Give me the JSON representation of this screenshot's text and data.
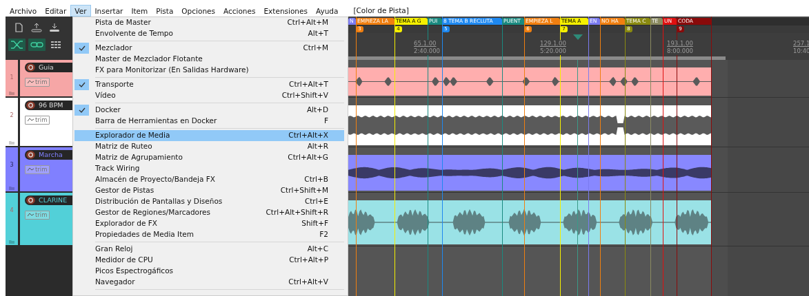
{
  "menubar": {
    "items": [
      {
        "label": "Archivo",
        "selected": false
      },
      {
        "label": "Editar",
        "selected": false
      },
      {
        "label": "Ver",
        "selected": true
      },
      {
        "label": "Insertar",
        "selected": false
      },
      {
        "label": "Item",
        "selected": false
      },
      {
        "label": "Pista",
        "selected": false
      },
      {
        "label": "Opciones",
        "selected": false
      },
      {
        "label": "Acciones",
        "selected": false
      },
      {
        "label": "Extensiones",
        "selected": false
      },
      {
        "label": "Ayuda",
        "selected": false
      }
    ],
    "status_text": "[Color de Pista]"
  },
  "view_menu": [
    {
      "kind": "item",
      "label": "Pista de Master",
      "shortcut": "Ctrl+Alt+M",
      "checked": false,
      "selected": false
    },
    {
      "kind": "item",
      "label": "Envolvente de Tempo",
      "shortcut": "Alt+T",
      "checked": false,
      "selected": false
    },
    {
      "kind": "separator"
    },
    {
      "kind": "item",
      "label": "Mezclador",
      "shortcut": "Ctrl+M",
      "checked": true,
      "selected": false
    },
    {
      "kind": "item",
      "label": "Master de Mezclador Flotante",
      "checked": false,
      "selected": false
    },
    {
      "kind": "item",
      "label": "FX para Monitorizar (En Salidas Hardware)",
      "checked": false,
      "selected": false
    },
    {
      "kind": "separator"
    },
    {
      "kind": "item",
      "label": "Transporte",
      "shortcut": "Ctrl+Alt+T",
      "checked": true,
      "selected": false
    },
    {
      "kind": "item",
      "label": "Vídeo",
      "shortcut": "Ctrl+Shift+V",
      "checked": false,
      "selected": false
    },
    {
      "kind": "separator"
    },
    {
      "kind": "item",
      "label": "Docker",
      "shortcut": "Alt+D",
      "checked": true,
      "selected": false
    },
    {
      "kind": "item",
      "label": "Barra de Herramientas en Docker",
      "shortcut": "F",
      "checked": false,
      "selected": false
    },
    {
      "kind": "separator"
    },
    {
      "kind": "item",
      "label": "Explorador de Media",
      "shortcut": "Ctrl+Alt+X",
      "checked": false,
      "selected": true
    },
    {
      "kind": "item",
      "label": "Matriz de Ruteo",
      "shortcut": "Alt+R",
      "checked": false,
      "selected": false
    },
    {
      "kind": "item",
      "label": "Matriz de Agrupamiento",
      "shortcut": "Ctrl+Alt+G",
      "checked": false,
      "selected": false
    },
    {
      "kind": "item",
      "label": "Track Wiring",
      "checked": false,
      "selected": false
    },
    {
      "kind": "item",
      "label": "Almacén de Proyecto/Bandeja FX",
      "shortcut": "Ctrl+B",
      "checked": false,
      "selected": false
    },
    {
      "kind": "item",
      "label": "Gestor de Pistas",
      "shortcut": "Ctrl+Shift+M",
      "checked": false,
      "selected": false
    },
    {
      "kind": "item",
      "label": "Distribución de Pantallas y Diseños",
      "shortcut": "Ctrl+E",
      "checked": false,
      "selected": false
    },
    {
      "kind": "item",
      "label": "Gestor de Regiones/Marcadores",
      "shortcut": "Ctrl+Alt+Shift+R",
      "checked": false,
      "selected": false
    },
    {
      "kind": "item",
      "label": "Explorador de FX",
      "shortcut": "Shift+F",
      "checked": false,
      "selected": false
    },
    {
      "kind": "item",
      "label": "Propiedades de Media Item",
      "shortcut": "F2",
      "checked": false,
      "selected": false
    },
    {
      "kind": "separator"
    },
    {
      "kind": "item",
      "label": "Gran Reloj",
      "shortcut": "Alt+C",
      "checked": false,
      "selected": false
    },
    {
      "kind": "item",
      "label": "Medidor de CPU",
      "shortcut": "Ctrl+Alt+P",
      "checked": false,
      "selected": false
    },
    {
      "kind": "item",
      "label": "Picos Espectrogáficos",
      "checked": false,
      "selected": false
    },
    {
      "kind": "item",
      "label": "Navegador",
      "shortcut": "Ctrl+Alt+V",
      "checked": false,
      "selected": false
    },
    {
      "kind": "separator"
    }
  ],
  "regions": [
    {
      "label": "N",
      "color": "#7b7bf0"
    },
    {
      "label": "EMPIEZA LA",
      "color": "#f07f10"
    },
    {
      "label": "TEMA A G",
      "color": "#f5f000"
    },
    {
      "label": "PUI",
      "color": "#1a8a80"
    },
    {
      "label": "8 TEMA B RECLUTA",
      "color": "#1e88f0"
    },
    {
      "label": "PUENT",
      "color": "#1a8a80"
    },
    {
      "label": "EMPIEZA L",
      "color": "#f07f10"
    },
    {
      "label": "TEMA A",
      "color": "#f5f000"
    },
    {
      "label": "EN",
      "color": "#7b7bf0"
    },
    {
      "label": "NO HA",
      "color": "#f07f10"
    },
    {
      "label": "TEMA C",
      "color": "#8a8a10"
    },
    {
      "label": "TE",
      "color": "#8a8a60"
    },
    {
      "label": "UN",
      "color": "#e01010"
    },
    {
      "label": "CODA",
      "color": "#8a0a0a"
    }
  ],
  "markers": [
    {
      "number": "3",
      "color": "#f07f10"
    },
    {
      "number": "4",
      "color": "#f5f000"
    },
    {
      "number": "5",
      "color": "#1e88f0"
    },
    {
      "number": "6",
      "color": "#f07f10"
    },
    {
      "number": "7",
      "color": "#f5f000"
    },
    {
      "number": "8",
      "color": "#8a8a10"
    },
    {
      "number": "9",
      "color": "#8a0a0a"
    }
  ],
  "ruler": [
    {
      "bar": "65.1.00",
      "time": "2:40.000"
    },
    {
      "bar": "129.1.00",
      "time": "5:20.000"
    },
    {
      "bar": "193.1.00",
      "time": "8:00.000"
    },
    {
      "bar": "257.1",
      "time": "10:40"
    }
  ],
  "tracks": [
    {
      "number": "1",
      "name": "Guia",
      "color": "#f6a6a6",
      "trim": "trim",
      "media_item": {
        "color": "#ffaeae"
      }
    },
    {
      "number": "2",
      "name": "96 BPM",
      "color": "#ffffff",
      "trim": "trim",
      "media_item": {
        "color": "#ffffff"
      }
    },
    {
      "number": "3",
      "name": "Marcha",
      "color": "#8080ff",
      "trim": "trim",
      "media_item": {
        "color": "#8888ff"
      }
    },
    {
      "number": "4",
      "name": "CLARINE",
      "color": "#52d0d8",
      "trim": "trim",
      "media_item": {
        "color": "#9ae2e6"
      }
    }
  ]
}
